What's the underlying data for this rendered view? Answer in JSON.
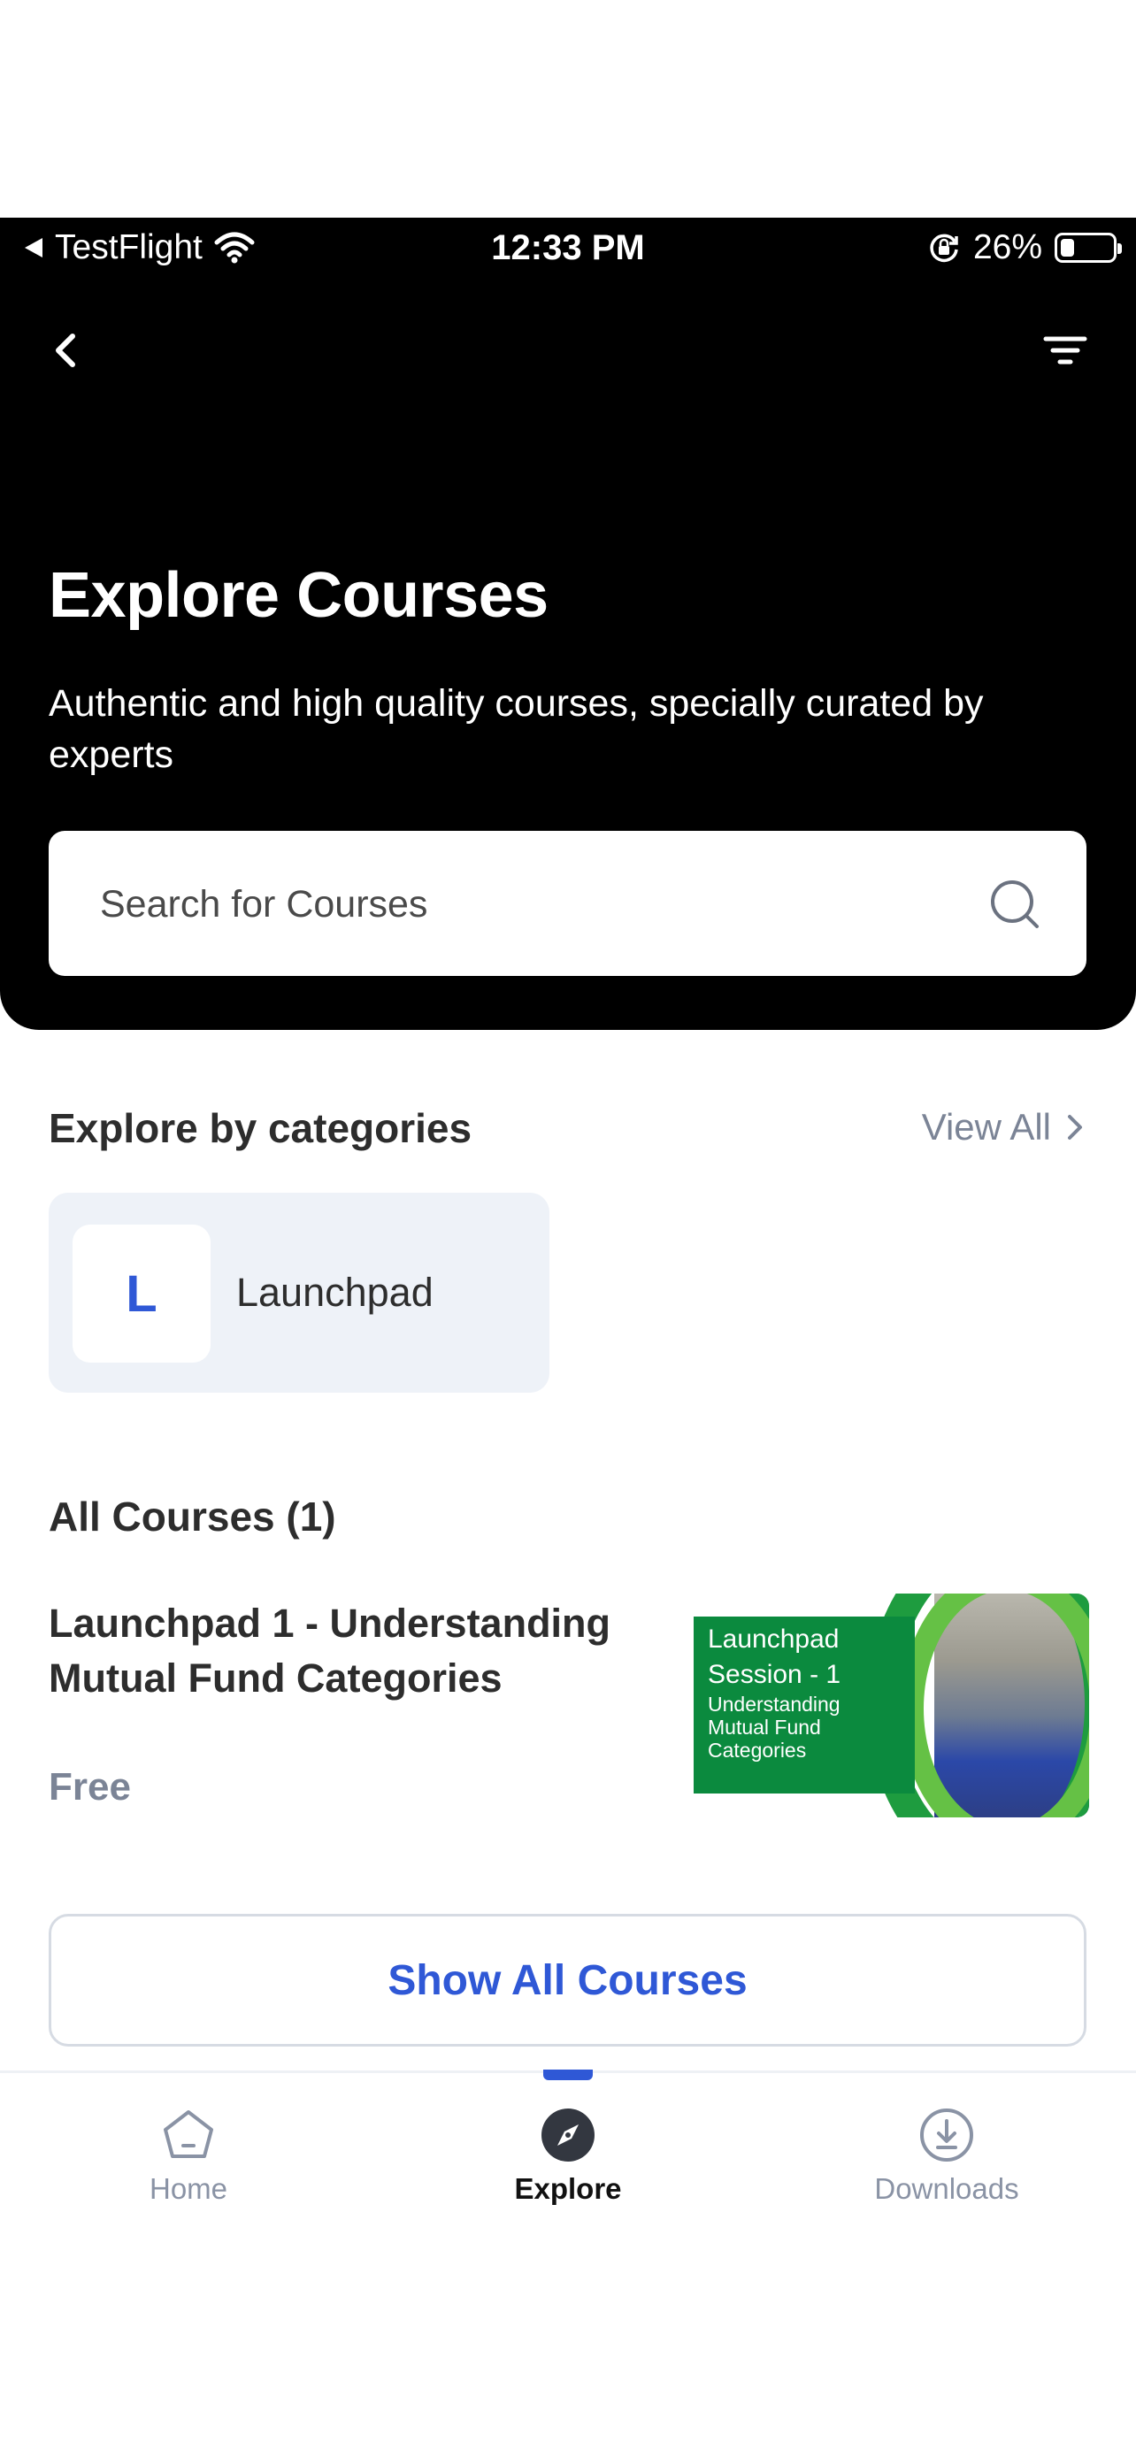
{
  "status_bar": {
    "carrier": "TestFlight",
    "time": "12:33 PM",
    "battery": "26%",
    "battery_level": 0.26
  },
  "header": {
    "back_icon": "chevron-left-icon",
    "filter_icon": "filter-lines-icon",
    "title": "Explore Courses",
    "subtitle": "Authentic and high quality courses, specially curated by experts"
  },
  "search": {
    "placeholder": "Search for Courses",
    "value": ""
  },
  "categories": {
    "title": "Explore by categories",
    "view_all": "View All",
    "items": [
      {
        "initial": "L",
        "label": "Launchpad"
      }
    ]
  },
  "courses": {
    "title": "All Courses (1)",
    "items": [
      {
        "title": "Launchpad 1 - Understanding Mutual Fund Categories",
        "price": "Free",
        "thumbnail": {
          "heading_line1": "Launchpad",
          "heading_line2": "Session - 1",
          "sub_line1": "Understanding",
          "sub_line2": "Mutual Fund",
          "sub_line3": "Categories"
        }
      }
    ],
    "show_all": "Show All Courses"
  },
  "tabbar": {
    "tabs": [
      {
        "label": "Home",
        "icon": "home-pentagon-icon",
        "active": false
      },
      {
        "label": "Explore",
        "icon": "compass-icon",
        "active": true
      },
      {
        "label": "Downloads",
        "icon": "download-circle-icon",
        "active": false
      }
    ]
  },
  "colors": {
    "accent": "#2f58d6",
    "hero_bg": "#000000",
    "muted_text": "#7b8496",
    "category_bg": "#eef2f8"
  }
}
